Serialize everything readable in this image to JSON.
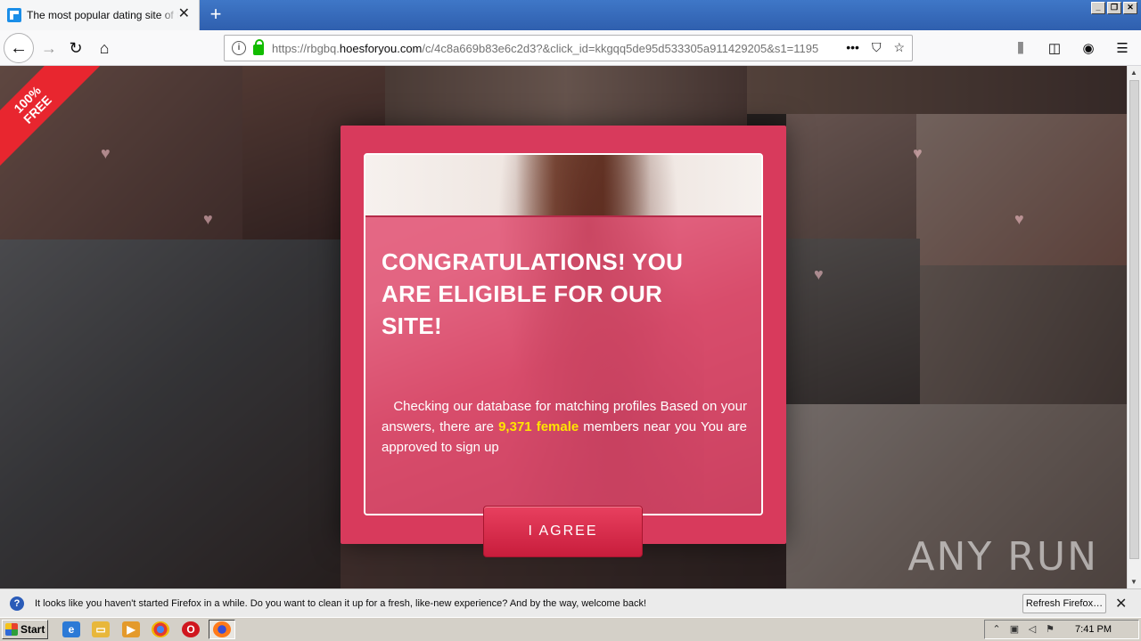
{
  "browser": {
    "tab_title": "The most popular dating site of the",
    "url_host_prefix": "https://rbgbq.",
    "url_host": "hoesforyou.com",
    "url_path": "/c/4c8a669b83e6c2d3?&click_id=kkgqq5de95d533305a911429205&s1=1195"
  },
  "page": {
    "ribbon_line1": "100%",
    "ribbon_line2": "FREE",
    "modal": {
      "title": "CONGRATULATIONS! YOU ARE ELIGIBLE FOR OUR SITE!",
      "body_prefix": "Checking our database for matching profiles Based on your answers, there are ",
      "body_highlight": "9,371 female",
      "body_suffix": " members near you You are approved to sign up",
      "agree_label": "I AGREE"
    },
    "watermark": "ANY RUN"
  },
  "notification": {
    "text": "It looks like you haven't started Firefox in a while. Do you want to clean it up for a fresh, like-new experience? And by the way, welcome back!",
    "button_label": "Refresh Firefox…"
  },
  "taskbar": {
    "start_label": "Start",
    "clock": "7:41 PM"
  },
  "colors": {
    "modal_bg": "#d83a5c",
    "highlight": "#ffe400",
    "ribbon": "#e8262f"
  }
}
